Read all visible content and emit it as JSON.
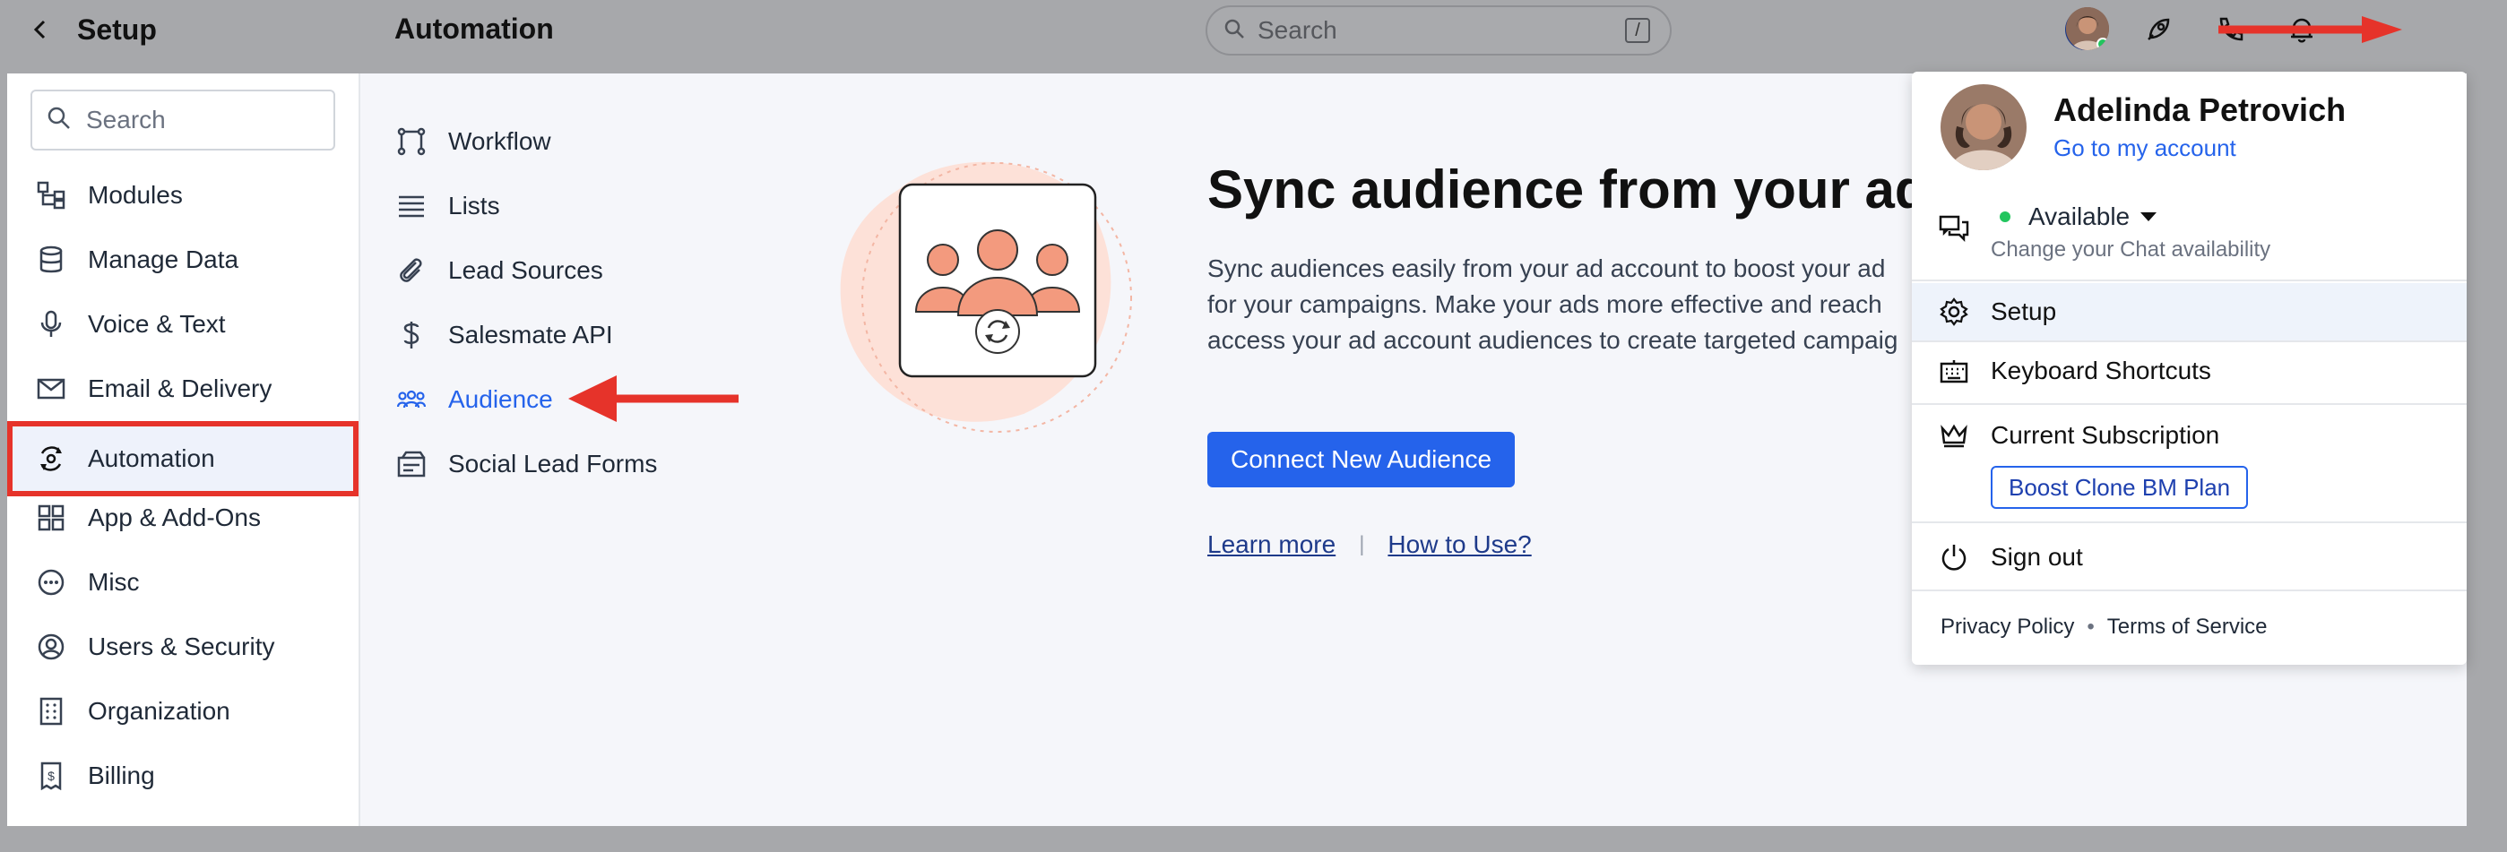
{
  "setup": {
    "title": "Setup"
  },
  "header": {
    "title": "Automation",
    "search_placeholder": "Search",
    "search_shortcut": "/"
  },
  "sidebar": {
    "search_placeholder": "Search",
    "items": [
      {
        "label": "Modules",
        "icon": "modules-icon"
      },
      {
        "label": "Manage Data",
        "icon": "database-icon"
      },
      {
        "label": "Voice & Text",
        "icon": "microphone-icon"
      },
      {
        "label": "Email & Delivery",
        "icon": "envelope-icon"
      },
      {
        "label": "Automation",
        "icon": "automation-icon",
        "active": true
      },
      {
        "label": "App & Add-Ons",
        "icon": "grid-icon"
      },
      {
        "label": "Misc",
        "icon": "more-circle-icon"
      },
      {
        "label": "Users & Security",
        "icon": "user-circle-icon"
      },
      {
        "label": "Organization",
        "icon": "building-icon"
      },
      {
        "label": "Billing",
        "icon": "receipt-icon"
      }
    ]
  },
  "submenu": {
    "items": [
      {
        "label": "Workflow",
        "icon": "workflow-icon"
      },
      {
        "label": "Lists",
        "icon": "list-icon"
      },
      {
        "label": "Lead Sources",
        "icon": "link-icon"
      },
      {
        "label": "Salesmate API",
        "icon": "api-icon"
      },
      {
        "label": "Audience",
        "icon": "audience-icon",
        "active": true
      },
      {
        "label": "Social Lead Forms",
        "icon": "form-icon"
      }
    ]
  },
  "hero": {
    "title": "Sync audience from your ads",
    "description": "Sync audiences easily from your ad account to boost your ad\nfor your campaigns. Make your ads more effective and reach\naccess your ad account audiences to create targeted campaig",
    "connect_label": "Connect New Audience",
    "learn_more": "Learn more ",
    "separator": "|",
    "how_to_use": "How to Use?"
  },
  "profile_menu": {
    "name": "Adelinda Petrovich",
    "account_link": "Go to my account",
    "status": "Available",
    "status_sub": "Change your Chat availability",
    "setup": "Setup",
    "shortcuts": "Keyboard Shortcuts",
    "subscription": "Current Subscription",
    "plan": "Boost Clone BM Plan",
    "sign_out": "Sign out",
    "privacy": "Privacy Policy",
    "terms": "Terms of Service",
    "footer_sep": "•"
  },
  "colors": {
    "accent": "#2563eb",
    "highlight_box": "#e6332a",
    "illustration": "#f39a7e"
  }
}
